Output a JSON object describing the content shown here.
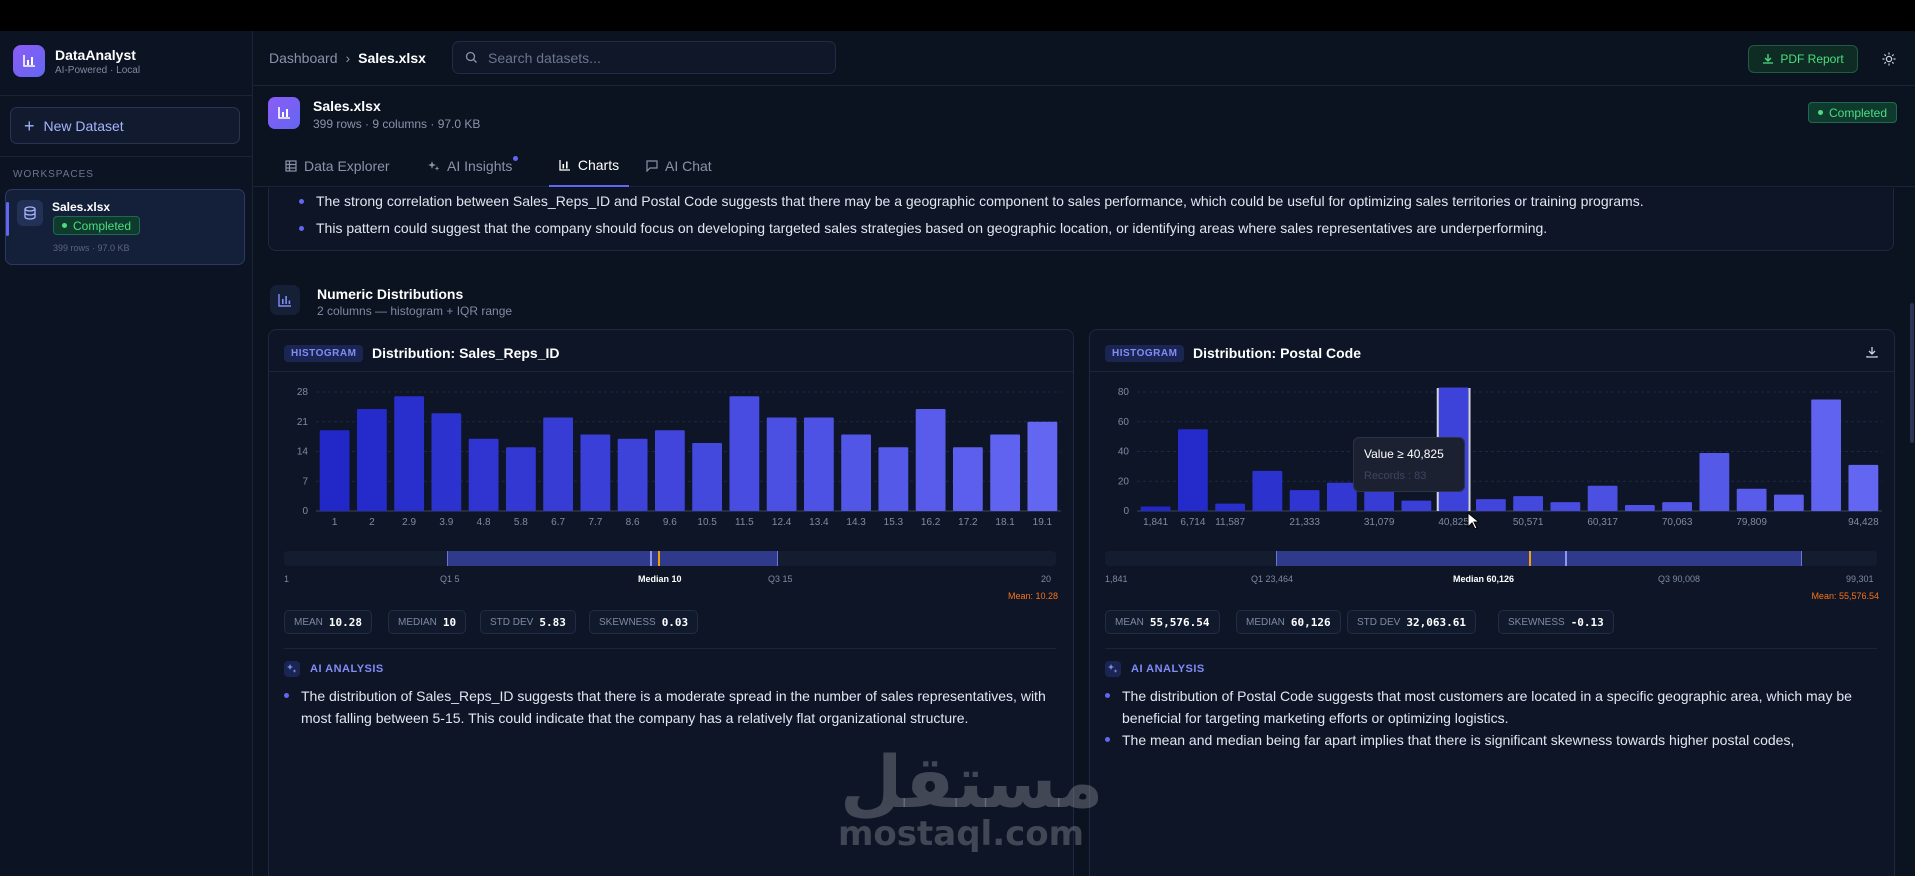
{
  "sidebar": {
    "brand_name": "DataAnalyst",
    "brand_tag": "AI-Powered · Local",
    "new_dataset": "New Dataset",
    "workspaces_label": "WORKSPACES",
    "workspace": {
      "name": "Sales.xlsx",
      "status": "Completed",
      "meta": "399 rows · 97.0 KB"
    }
  },
  "topbar": {
    "breadcrumb_root": "Dashboard",
    "breadcrumb_sep": "›",
    "breadcrumb_current": "Sales.xlsx",
    "search_placeholder": "Search datasets...",
    "pdf_label": "PDF Report"
  },
  "file": {
    "name": "Sales.xlsx",
    "meta": "399 rows · 9 columns · 97.0 KB",
    "status": "Completed"
  },
  "tabs": [
    {
      "label": "Data Explorer",
      "icon": "table-icon"
    },
    {
      "label": "AI Insights",
      "icon": "sparkle-icon"
    },
    {
      "label": "Charts",
      "icon": "bar-chart-icon"
    },
    {
      "label": "AI Chat",
      "icon": "chat-icon"
    }
  ],
  "insights": [
    "The strong correlation between Sales_Reps_ID and Postal Code suggests that there may be a geographic component to sales performance, which could be useful for optimizing sales territories or training programs.",
    "This pattern could suggest that the company should focus on developing targeted sales strategies based on geographic location, or identifying areas where sales representatives are underperforming."
  ],
  "section": {
    "title": "Numeric Distributions",
    "subtitle": "2 columns — histogram + IQR range"
  },
  "panels": [
    {
      "tag": "HISTOGRAM",
      "title": "Distribution: Sales_Reps_ID",
      "iqr": {
        "min": "1",
        "q1": "Q1 5",
        "median": "Median 10",
        "q3": "Q3 15",
        "max": "20",
        "mean": "Mean: 10.28"
      },
      "stats": [
        {
          "label": "MEAN",
          "value": "10.28"
        },
        {
          "label": "MEDIAN",
          "value": "10"
        },
        {
          "label": "STD DEV",
          "value": "5.83"
        },
        {
          "label": "SKEWNESS",
          "value": "0.03"
        }
      ],
      "ai_label": "AI ANALYSIS",
      "analysis": [
        "The distribution of Sales_Reps_ID suggests that there is a moderate spread in the number of sales representatives, with most falling between 5-15. This could indicate that the company has a relatively flat organizational structure."
      ]
    },
    {
      "tag": "HISTOGRAM",
      "title": "Distribution: Postal Code",
      "iqr": {
        "min": "1,841",
        "q1": "Q1 23,464",
        "median": "Median 60,126",
        "q3": "Q3 90,008",
        "max": "99,301",
        "mean": "Mean: 55,576.54"
      },
      "stats": [
        {
          "label": "MEAN",
          "value": "55,576.54"
        },
        {
          "label": "MEDIAN",
          "value": "60,126"
        },
        {
          "label": "STD DEV",
          "value": "32,063.61"
        },
        {
          "label": "SKEWNESS",
          "value": "-0.13"
        }
      ],
      "ai_label": "AI ANALYSIS",
      "analysis": [
        "The distribution of Postal Code suggests that most customers are located in a specific geographic area, which may be beneficial for targeting marketing efforts or optimizing logistics.",
        "The mean and median being far apart implies that there is significant skewness towards higher postal codes,"
      ],
      "tooltip": {
        "line1": "Value ≥ 40,825",
        "line2": "Records : 83"
      }
    }
  ],
  "chart_data": [
    {
      "type": "bar",
      "title": "Distribution: Sales_Reps_ID",
      "categories": [
        "1",
        "2",
        "2.9",
        "3.9",
        "4.8",
        "5.8",
        "6.7",
        "7.7",
        "8.6",
        "9.6",
        "10.5",
        "11.5",
        "12.4",
        "13.4",
        "14.3",
        "15.3",
        "16.2",
        "17.2",
        "18.1",
        "19.1"
      ],
      "values": [
        19,
        24,
        27,
        23,
        17,
        15,
        22,
        18,
        17,
        19,
        16,
        27,
        22,
        22,
        18,
        15,
        24,
        15,
        18,
        21
      ],
      "yticks": [
        0,
        7,
        14,
        21,
        28
      ],
      "ylim": [
        0,
        28
      ]
    },
    {
      "type": "bar",
      "title": "Distribution: Postal Code",
      "categories": [
        "1,841",
        "6,714",
        "11,587",
        "16,460",
        "21,333",
        "26,206",
        "31,079",
        "35,952",
        "40,825",
        "45,698",
        "50,571",
        "55,444",
        "60,317",
        "65,190",
        "70,063",
        "74,936",
        "79,809",
        "84,682",
        "89,555",
        "94,428"
      ],
      "values": [
        3,
        55,
        5,
        27,
        14,
        19,
        17,
        7,
        83,
        8,
        10,
        6,
        17,
        4,
        6,
        39,
        15,
        11,
        75,
        31
      ],
      "shown_tick_labels": [
        "1,841",
        "6,714",
        "11,587",
        "21,333",
        "31,079",
        "40,825",
        "50,571",
        "60,317",
        "70,063",
        "79,809",
        "94,428"
      ],
      "highlight_index": 8,
      "yticks": [
        0,
        20,
        40,
        60,
        80
      ],
      "ylim": [
        0,
        80
      ]
    }
  ],
  "watermark": {
    "arabic": "مستقل",
    "latin": "mostaql.com"
  },
  "colors": {
    "accent": "#6366f1",
    "success": "#4ade80",
    "mean_marker": "#f59e0b",
    "background": "#0b1220"
  }
}
